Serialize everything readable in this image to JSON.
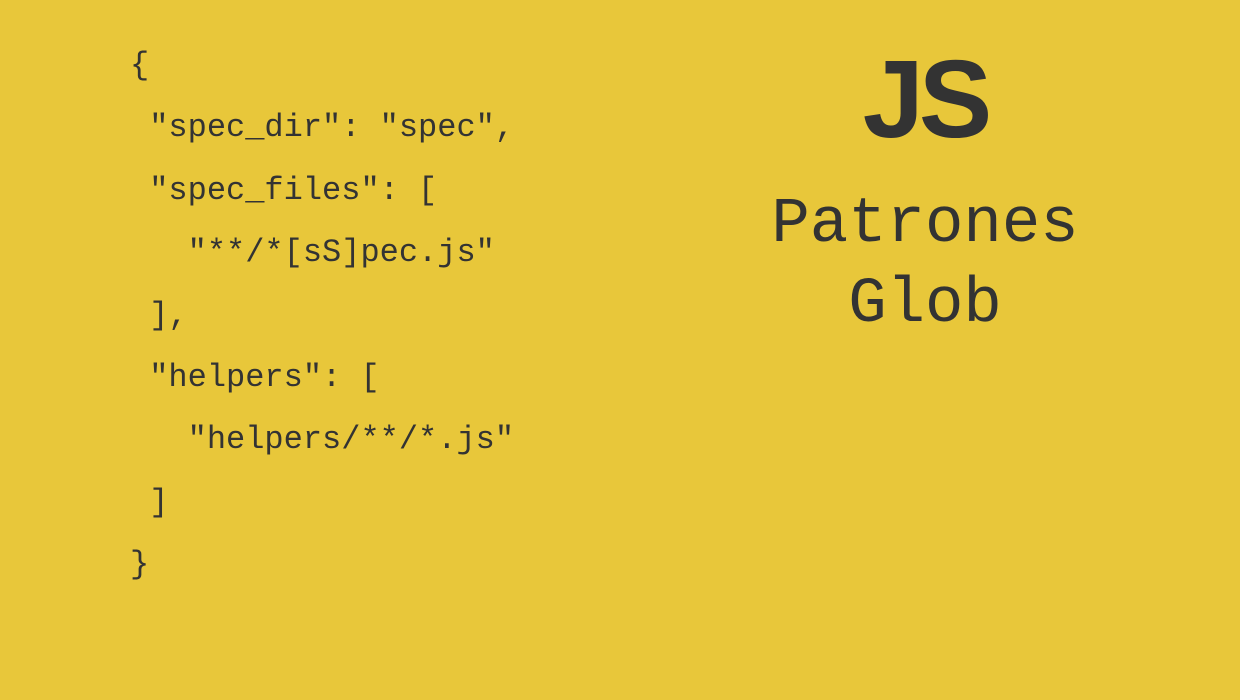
{
  "code": {
    "line1": "{",
    "line2": " \"spec_dir\": \"spec\",",
    "line3": " \"spec_files\": [",
    "line4": "   \"**/*[sS]pec.js\"",
    "line5": " ],",
    "line6": " \"helpers\": [",
    "line7": "   \"helpers/**/*.js\"",
    "line8": " ]",
    "line9": "}"
  },
  "logo": "JS",
  "title": {
    "line1": "Patrones",
    "line2": "Glob"
  }
}
